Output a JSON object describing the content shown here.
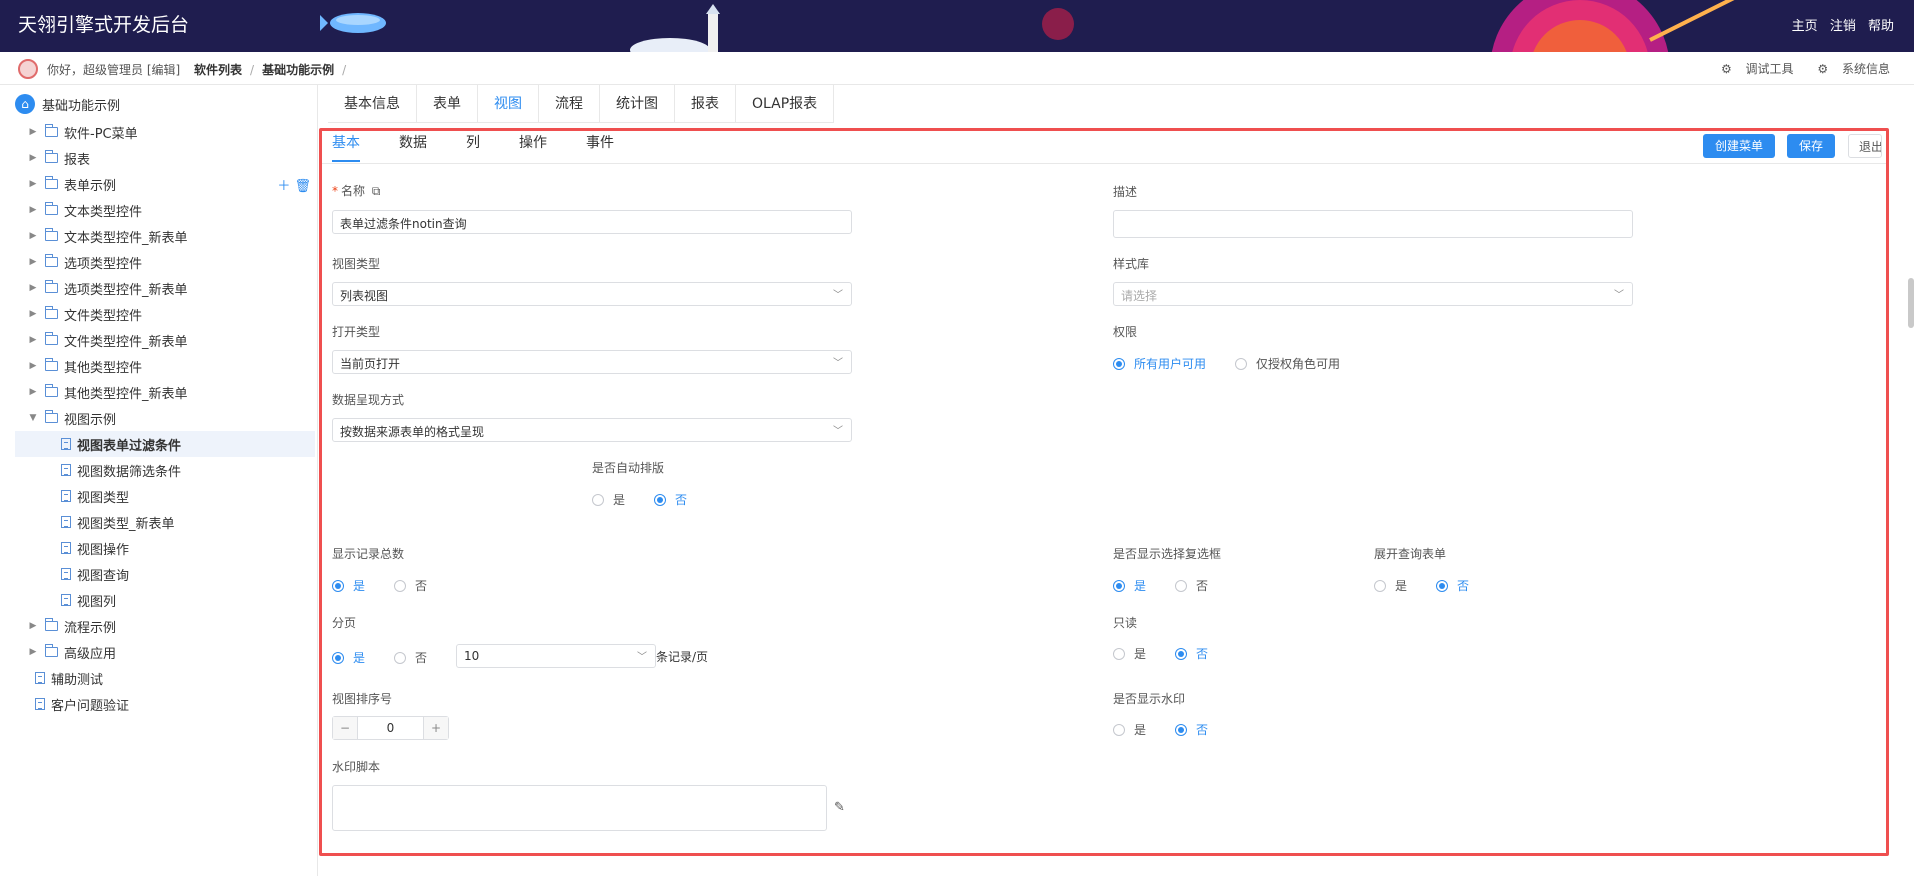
{
  "header": {
    "title": "天翎引擎式开发后台",
    "links": [
      "主页",
      "注销",
      "帮助"
    ]
  },
  "breadcrumb": {
    "greeting": "你好，超级管理员 [编辑]",
    "items": [
      "软件列表",
      "基础功能示例"
    ],
    "sep": "/",
    "tools": [
      "调试工具",
      "系统信息"
    ]
  },
  "tree": {
    "root": "基础功能示例",
    "items": [
      {
        "label": "软件-PC菜单",
        "type": "folder",
        "expanded": false
      },
      {
        "label": "报表",
        "type": "folder",
        "expanded": false
      },
      {
        "label": "表单示例",
        "type": "folder",
        "expanded": false
      },
      {
        "label": "文本类型控件",
        "type": "folder",
        "expanded": false
      },
      {
        "label": "文本类型控件_新表单",
        "type": "folder",
        "expanded": false
      },
      {
        "label": "选项类型控件",
        "type": "folder",
        "expanded": false
      },
      {
        "label": "选项类型控件_新表单",
        "type": "folder",
        "expanded": false
      },
      {
        "label": "文件类型控件",
        "type": "folder",
        "expanded": false
      },
      {
        "label": "文件类型控件_新表单",
        "type": "folder",
        "expanded": false
      },
      {
        "label": "其他类型控件",
        "type": "folder",
        "expanded": false
      },
      {
        "label": "其他类型控件_新表单",
        "type": "folder",
        "expanded": false
      },
      {
        "label": "视图示例",
        "type": "folder",
        "expanded": true
      },
      {
        "label": "视图表单过滤条件",
        "type": "doc",
        "active": true
      },
      {
        "label": "视图数据筛选条件",
        "type": "doc"
      },
      {
        "label": "视图类型",
        "type": "doc"
      },
      {
        "label": "视图类型_新表单",
        "type": "doc"
      },
      {
        "label": "视图操作",
        "type": "doc"
      },
      {
        "label": "视图查询",
        "type": "doc"
      },
      {
        "label": "视图列",
        "type": "doc"
      },
      {
        "label": "流程示例",
        "type": "folder",
        "expanded": false
      },
      {
        "label": "高级应用",
        "type": "folder",
        "expanded": false
      },
      {
        "label": "辅助测试",
        "type": "doc"
      },
      {
        "label": "客户问题验证",
        "type": "doc"
      }
    ]
  },
  "view_tabs": [
    "基本信息",
    "表单",
    "视图",
    "流程",
    "统计图",
    "报表",
    "OLAP报表"
  ],
  "view_tab_active": "视图",
  "inner_tabs": [
    "基本",
    "数据",
    "列",
    "操作",
    "事件"
  ],
  "inner_tab_active": "基本",
  "buttons": {
    "create_menu": "创建菜单",
    "save": "保存",
    "exit": "退出"
  },
  "form": {
    "name_label": "名称",
    "name_value": "表单过滤条件notin查询",
    "desc_label": "描述",
    "desc_value": "",
    "view_type_label": "视图类型",
    "view_type_value": "列表视图",
    "style_lib_label": "样式库",
    "style_lib_placeholder": "请选择",
    "open_type_label": "打开类型",
    "open_type_value": "当前页打开",
    "perm_label": "权限",
    "perm_options": [
      "所有用户可用",
      "仅授权角色可用"
    ],
    "perm_selected": 0,
    "present_label": "数据呈现方式",
    "present_value": "按数据来源表单的格式呈现",
    "auto_layout_label": "是否自动排版",
    "auto_layout_selected": "否",
    "show_total_label": "显示记录总数",
    "show_total_selected": "是",
    "show_checkbox_label": "是否显示选择复选框",
    "show_checkbox_selected": "是",
    "expand_query_label": "展开查询表单",
    "expand_query_selected": "否",
    "paging_label": "分页",
    "paging_selected": "是",
    "page_size": "10",
    "page_size_suffix": "条记录/页",
    "readonly_label": "只读",
    "readonly_selected": "否",
    "order_label": "视图排序号",
    "order_value": "0",
    "watermark_label": "是否显示水印",
    "watermark_selected": "否",
    "wm_script_label": "水印脚本",
    "yes": "是",
    "no": "否"
  },
  "colors": {
    "accent": "#2d8cf0",
    "header_bg": "#1f1d4f",
    "highlight_border": "#ef4f4f"
  }
}
